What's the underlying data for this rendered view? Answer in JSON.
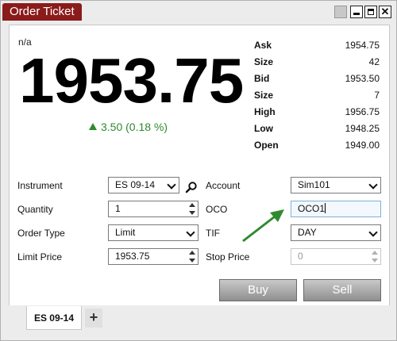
{
  "window": {
    "title": "Order Ticket"
  },
  "ticker": {
    "instrument_display": "n/a",
    "last_price": "1953.75",
    "net_change": "3.50 (0.18 %)"
  },
  "quote": [
    {
      "label": "Ask",
      "value": "1954.75"
    },
    {
      "label": "Size",
      "value": "42"
    },
    {
      "label": "Bid",
      "value": "1953.50"
    },
    {
      "label": "Size",
      "value": "7"
    },
    {
      "label": "High",
      "value": "1956.75"
    },
    {
      "label": "Low",
      "value": "1948.25"
    },
    {
      "label": "Open",
      "value": "1949.00"
    }
  ],
  "form": {
    "instrument_label": "Instrument",
    "instrument_value": "ES 09-14",
    "account_label": "Account",
    "account_value": "Sim101",
    "quantity_label": "Quantity",
    "quantity_value": "1",
    "oco_label": "OCO",
    "oco_value": "OCO1",
    "order_type_label": "Order Type",
    "order_type_value": "Limit",
    "tif_label": "TIF",
    "tif_value": "DAY",
    "limit_price_label": "Limit Price",
    "limit_price_value": "1953.75",
    "stop_price_label": "Stop Price",
    "stop_price_value": "0"
  },
  "actions": {
    "buy_label": "Buy",
    "sell_label": "Sell"
  },
  "tabs": [
    {
      "label": "ES 09-14"
    }
  ],
  "tab_add_label": "+",
  "colors": {
    "title_bg": "#8b1a1a",
    "positive": "#2e8b2e",
    "annotation_arrow": "#2e8b2e"
  }
}
